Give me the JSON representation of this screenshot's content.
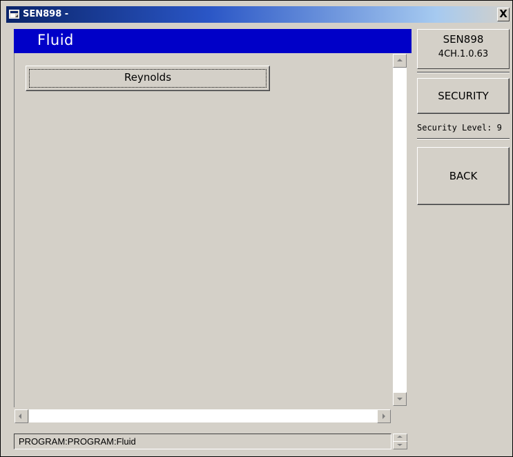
{
  "window": {
    "title": "SEN898 -",
    "close_label": "X"
  },
  "header": {
    "title": "Fluid"
  },
  "list": {
    "items": [
      {
        "label": "Reynolds"
      }
    ]
  },
  "status_bar": {
    "text": "PROGRAM:PROGRAM:Fluid"
  },
  "right_panel": {
    "device_name": "SEN898",
    "version": "4CH.1.0.63",
    "security_button": "SECURITY",
    "security_level": "Security Level: 9",
    "back_button": "BACK"
  },
  "colors": {
    "header_bg": "#0000c8",
    "window_bg": "#d4d0c8",
    "titlebar_start": "#0a246a"
  },
  "icons": {
    "title_icon": "app-window-icon",
    "close_icon": "close-icon"
  }
}
